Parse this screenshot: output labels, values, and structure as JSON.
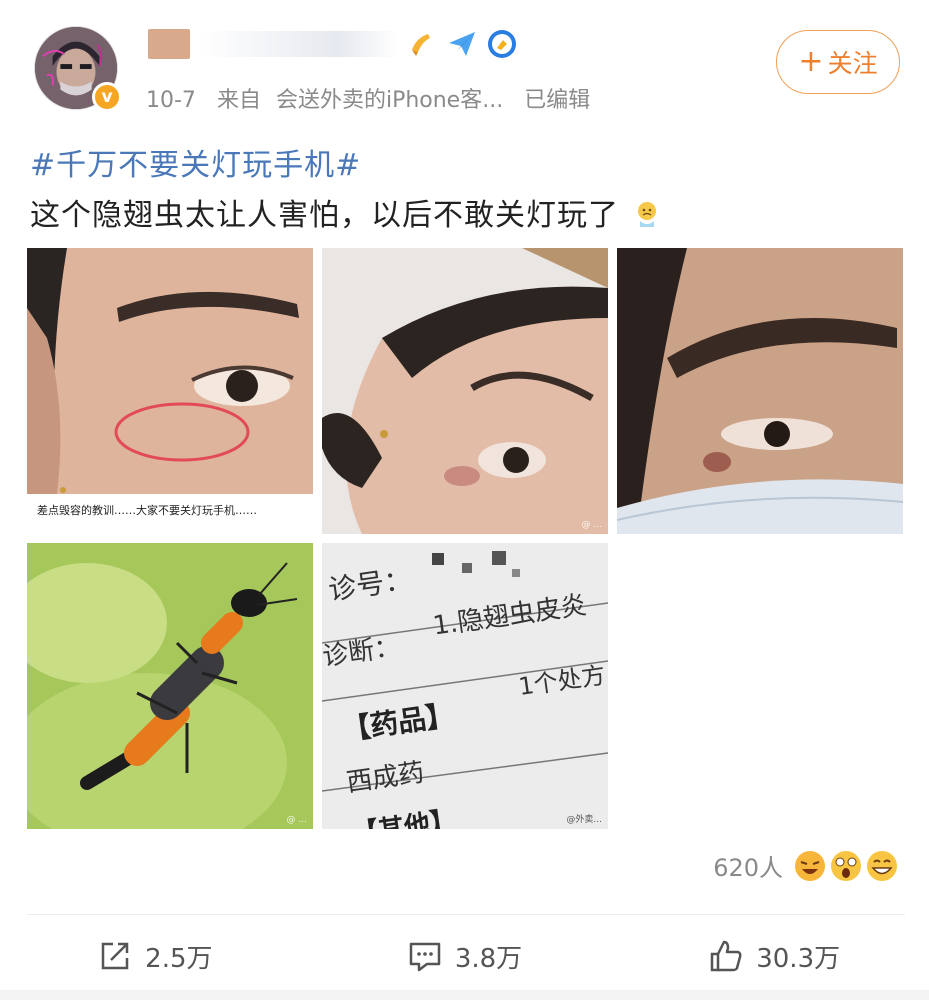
{
  "post": {
    "time": "10-7",
    "source_prefix": "来自",
    "source": "会送外卖的iPhone客...",
    "edited": "已编辑",
    "topic": "#千万不要关灯玩手机#",
    "text": "这个隐翅虫太让人害怕，以后不敢关灯玩了",
    "follow_label": "关注",
    "follow_plus": "+"
  },
  "images": [
    {
      "name": "eye-close-up-circled",
      "caption": "差点毁容的教训……大家不要关灯玩手机……"
    },
    {
      "name": "face-side-view",
      "watermark": "@ ..."
    },
    {
      "name": "eye-with-mask",
      "watermark": ""
    },
    {
      "name": "rove-beetle",
      "watermark": "@ ..."
    },
    {
      "name": "diagnosis-slip",
      "watermark": "@外卖..."
    }
  ],
  "diagnosis": {
    "line1": "诊号：",
    "line2": "诊断：",
    "diag": "1.隐翅虫皮炎",
    "rx": "1个处方",
    "drugs": "【药品】",
    "western": "西成药",
    "other": "【其他】"
  },
  "reactions": {
    "count": "620人"
  },
  "actions": {
    "repost": "2.5万",
    "comment": "3.8万",
    "like": "30.3万"
  },
  "colors": {
    "topic": "#4a78b8",
    "follow": "#ee7f2e",
    "verified": "#f5a623"
  }
}
